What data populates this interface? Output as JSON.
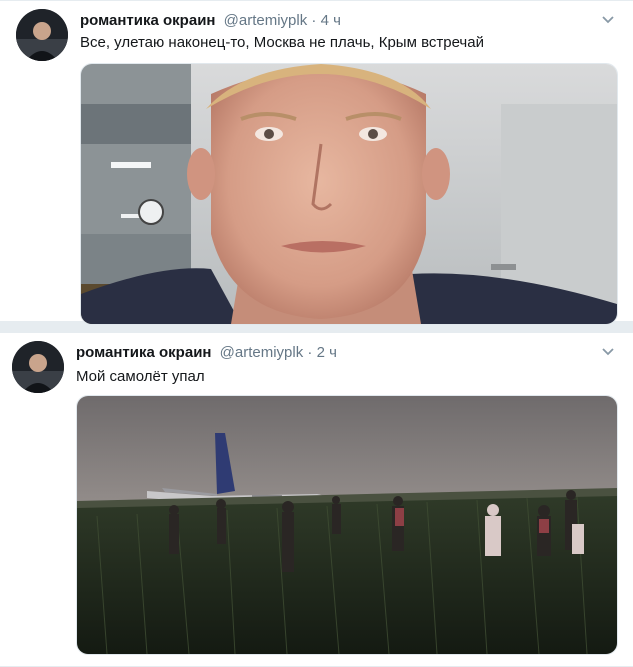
{
  "tweets": [
    {
      "author_name": "романтика окраин",
      "handle": "@artemiyplk",
      "separator": "·",
      "time": "4 ч",
      "text": "Все, улетаю наконец-то, Москва не плачь, Крым встречай",
      "avatar_icon": "user-avatar",
      "menu_icon": "chevron-down-icon",
      "media": "selfie-photo-airport"
    },
    {
      "author_name": "романтика окраин",
      "handle": "@artemiyplk",
      "separator": "·",
      "time": "2 ч",
      "text": "Мой самолёт упал",
      "avatar_icon": "user-avatar",
      "menu_icon": "chevron-down-icon",
      "media": "airplane-in-cornfield-photo"
    }
  ],
  "colors": {
    "background": "#e6ecf0",
    "card": "#ffffff",
    "primary_text": "#14171a",
    "secondary_text": "#657786"
  }
}
